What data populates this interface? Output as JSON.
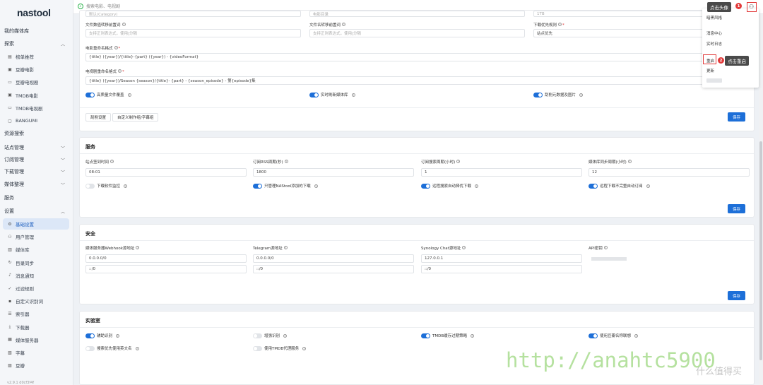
{
  "app": {
    "logo": "nastool",
    "search_placeholder": "搜索电影、电视剧"
  },
  "sidebar": {
    "my_media": "我的媒体库",
    "explore": "探索",
    "explore_items": [
      {
        "label": "榜单推荐",
        "icon": "chart-icon"
      },
      {
        "label": "豆瓣电影",
        "icon": "film-icon"
      },
      {
        "label": "豆瓣电视剧",
        "icon": "tv-icon"
      },
      {
        "label": "TMDB电影",
        "icon": "film-icon"
      },
      {
        "label": "TMDB电视剧",
        "icon": "tv-icon"
      },
      {
        "label": "BANGUMI",
        "icon": "anime-icon"
      }
    ],
    "resource_search": "资源搜索",
    "site_mgmt": "站点管理",
    "sub_mgmt": "订阅管理",
    "download_mgmt": "下载管理",
    "media_org": "媒体整理",
    "service": "服务",
    "settings": "设置",
    "settings_items": [
      {
        "label": "基础设置",
        "icon": "gear-icon",
        "active": true
      },
      {
        "label": "用户管理",
        "icon": "users-icon"
      },
      {
        "label": "媒体库",
        "icon": "library-icon"
      },
      {
        "label": "目录同步",
        "icon": "sync-icon"
      },
      {
        "label": "消息通知",
        "icon": "bell-icon"
      },
      {
        "label": "过滤规则",
        "icon": "filter-icon"
      },
      {
        "label": "自定义识别词",
        "icon": "tag-icon"
      },
      {
        "label": "索引器",
        "icon": "index-icon"
      },
      {
        "label": "下载器",
        "icon": "download-icon"
      },
      {
        "label": "媒体服务器",
        "icon": "server-icon"
      },
      {
        "label": "字幕",
        "icon": "subtitle-icon"
      },
      {
        "label": "豆瓣",
        "icon": "douban-icon"
      }
    ]
  },
  "media_card": {
    "row0": [
      "默认(Category)",
      "电影目录",
      "1TB"
    ],
    "movie_file_rule_label": "文件数值转移前置词",
    "movie_file_rule_ph": "支持正则表达式，使用|分隔",
    "tv_file_rule_label": "文件名转移前置词",
    "tv_file_rule_ph": "支持正则表达式，使用|分隔",
    "download_priority_label": "下载优先规则",
    "download_priority_value": "站点优先",
    "movie_name_label": "电影重命名格式",
    "movie_name_value": "{title} ({year})/{title}-{part} ({year}) - {videoFormat}",
    "tv_name_label": "电视剧重命名格式",
    "tv_name_value": "{title} ({year})/Season {season}/{title}- {part} - {season_episode} - 第{episode}集",
    "toggles": [
      "高质量文件覆盖",
      "实时刷新媒体库",
      "刮削元数据及图片"
    ],
    "btn_scrape": "刮削设置",
    "btn_custom": "自定义制作组/字幕组",
    "save": "保存"
  },
  "service_card": {
    "title": "服务",
    "fields": [
      {
        "label": "站点签到时间",
        "value": "08:01"
      },
      {
        "label": "订阅RSS周期(秒)",
        "value": "1800"
      },
      {
        "label": "订阅搜索周期(小时)",
        "value": "1"
      },
      {
        "label": "媒体库同步周期(小时)",
        "value": "12"
      }
    ],
    "toggles": [
      {
        "label": "下载软件监控",
        "on": false
      },
      {
        "label": "只管理NAStool添加的下载",
        "on": true
      },
      {
        "label": "远程搜索自动择优下载",
        "on": true
      },
      {
        "label": "远程下载不完整自动订阅",
        "on": true
      }
    ],
    "save": "保存"
  },
  "security_card": {
    "title": "安全",
    "fields": [
      {
        "label": "媒体服务器Webhook源地址",
        "v1": "0.0.0.0/0",
        "v2": "::/0"
      },
      {
        "label": "Telegram源地址",
        "v1": "0.0.0.0/0",
        "v2": "::/0"
      },
      {
        "label": "Synology Chat源地址",
        "v1": "127.0.0.1",
        "v2": "::/0"
      },
      {
        "label": "API密钥",
        "v1": "",
        "v2": ""
      }
    ],
    "save": "保存"
  },
  "lab_card": {
    "title": "实验室",
    "toggles": [
      {
        "label": "辅助识别",
        "on": true
      },
      {
        "label": "增强识别",
        "on": false
      },
      {
        "label": "TMDB缓存过期策略",
        "on": true
      },
      {
        "label": "使用豆瓣名称联想",
        "on": true
      },
      {
        "label": "搜索优先使用英文名",
        "on": false
      },
      {
        "label": "使用TMDB代理服务",
        "on": false
      }
    ]
  },
  "dropdown": {
    "items": [
      "暗黑风格",
      "消息中心",
      "实时日志",
      "重启",
      "更新"
    ],
    "tip_avatar": "点击头像",
    "tip_restart": "点击重启",
    "badge1": "1",
    "badge2": "2"
  },
  "watermark": "http://anahtc5900",
  "watermark2": "什么值得买",
  "version": "v2.9.1 d0cf3f4f"
}
